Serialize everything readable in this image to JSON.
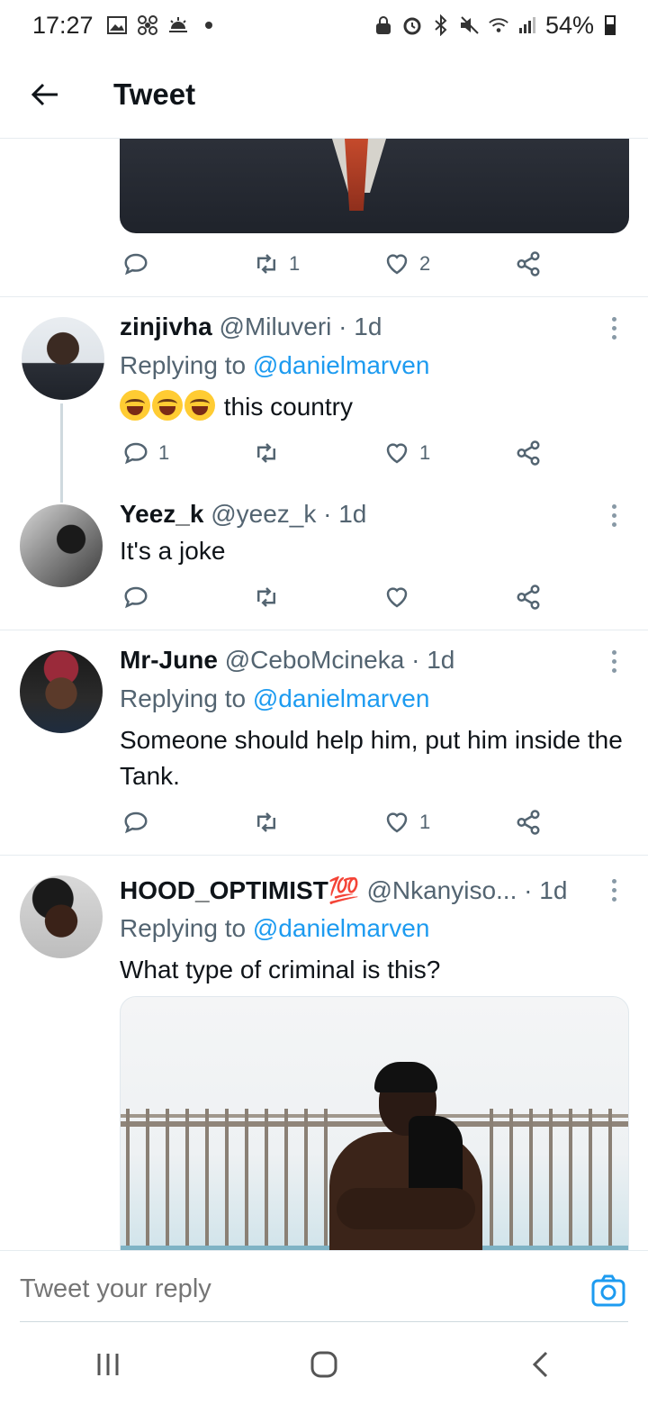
{
  "status_bar": {
    "time": "17:27",
    "battery": "54%"
  },
  "app_bar": {
    "title": "Tweet"
  },
  "main_tweet": {
    "retweets": "1",
    "likes": "2"
  },
  "replies": [
    {
      "name": "zinjivha",
      "handle": "@Miluveri",
      "time": "· 1d",
      "replying_prefix": "Replying to",
      "replying_to": "@danielmarven",
      "text": "this country",
      "replies_count": "1",
      "likes": "1"
    },
    {
      "name": "Yeez_k",
      "handle": "@yeez_k",
      "time": "· 1d",
      "text": "It's a joke"
    },
    {
      "name": "Mr-June",
      "handle": "@CeboMcineka",
      "time": "· 1d",
      "replying_prefix": "Replying to",
      "replying_to": "@danielmarven",
      "text": "Someone should help him, put him inside the Tank.",
      "likes": "1"
    },
    {
      "name": "HOOD_OPTIMIST💯",
      "handle": "@Nkanyiso...",
      "time": "· 1d",
      "replying_prefix": "Replying to",
      "replying_to": "@danielmarven",
      "text": "What type of criminal is this?"
    }
  ],
  "composer": {
    "placeholder": "Tweet your reply"
  },
  "icons": {
    "reply": "reply-icon",
    "retweet": "retweet-icon",
    "like": "heart-icon",
    "share": "share-icon",
    "back": "arrow-left-icon",
    "camera": "camera-icon",
    "more": "more-vertical-icon"
  }
}
